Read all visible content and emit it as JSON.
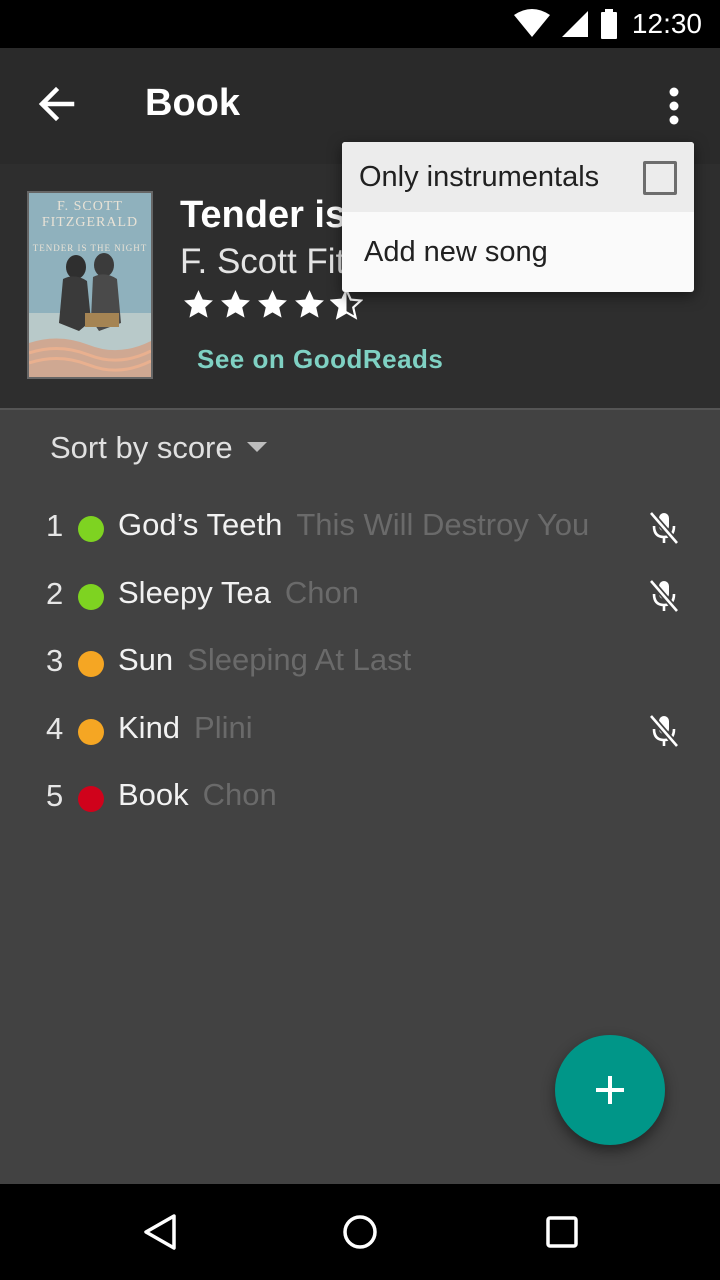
{
  "status_bar": {
    "time": "12:30"
  },
  "toolbar": {
    "title": "Book"
  },
  "book": {
    "title": "Tender is the Night",
    "author": "F. Scott Fitzgerald",
    "rating_stars": 4.5,
    "goodreads_link": "See on GoodReads",
    "cover": {
      "author_line1": "F. SCOTT",
      "author_line2": "FITZGERALD",
      "title_line": "TENDER IS THE NIGHT"
    }
  },
  "sort": {
    "label": "Sort by score"
  },
  "songs": [
    {
      "rank": "1",
      "title": "God’s Teeth",
      "artist": "This Will Destroy You",
      "dot_color": "#7ed321",
      "instrumental": true
    },
    {
      "rank": "2",
      "title": "Sleepy Tea",
      "artist": "Chon",
      "dot_color": "#7ed321",
      "instrumental": true
    },
    {
      "rank": "3",
      "title": "Sun",
      "artist": "Sleeping At Last",
      "dot_color": "#f5a623",
      "instrumental": false
    },
    {
      "rank": "4",
      "title": "Kind",
      "artist": "Plini",
      "dot_color": "#f5a623",
      "instrumental": true
    },
    {
      "rank": "5",
      "title": "Book",
      "artist": "Chon",
      "dot_color": "#d0021b",
      "instrumental": false
    }
  ],
  "menu": {
    "only_instrumentals": {
      "label": "Only instrumentals",
      "checked": false
    },
    "add_new_song": {
      "label": "Add new song"
    }
  },
  "colors": {
    "accent": "#009688",
    "link": "#7fd1c3",
    "toolbar": "#2a2a2a",
    "background": "#424242"
  }
}
